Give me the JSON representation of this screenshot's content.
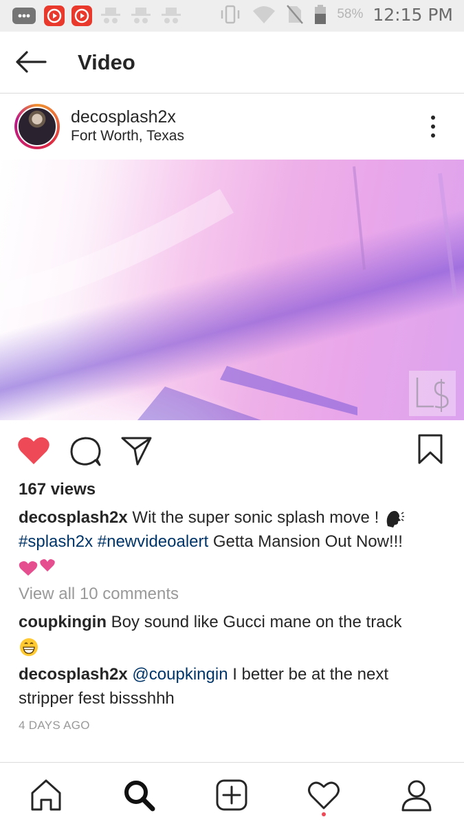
{
  "status_bar": {
    "battery_percent": "58%",
    "time": "12:15 PM",
    "icons": [
      "chat-bubble-icon",
      "video-app-icon",
      "video-app-icon",
      "incognito-icon",
      "incognito-icon",
      "incognito-icon",
      "vibrate-icon",
      "wifi-icon",
      "no-sim-icon",
      "battery-icon"
    ]
  },
  "header": {
    "title": "Video"
  },
  "post": {
    "username": "decosplash2x",
    "location": "Fort Worth, Texas",
    "views": "167 views",
    "caption": {
      "username": "decosplash2x",
      "text": " Wit the super sonic splash move ! ",
      "hashtag1": "#splash2x",
      "hashtag2": "#newvideoalert",
      "text2": " Getta Mansion Out Now!!!"
    },
    "view_all_comments": "View all 10 comments",
    "comments": [
      {
        "username": "coupkingin",
        "text": " Boy sound like Gucci mane on the track"
      },
      {
        "username": "decosplash2x",
        "mention": "@coupkingin",
        "text": " I better be at the next stripper fest bissshhh"
      }
    ],
    "timestamp": "4 DAYS AGO",
    "liked": true
  },
  "colors": {
    "like_red": "#ed4956",
    "hashtag_blue": "#003569",
    "muted_gray": "#999999"
  }
}
